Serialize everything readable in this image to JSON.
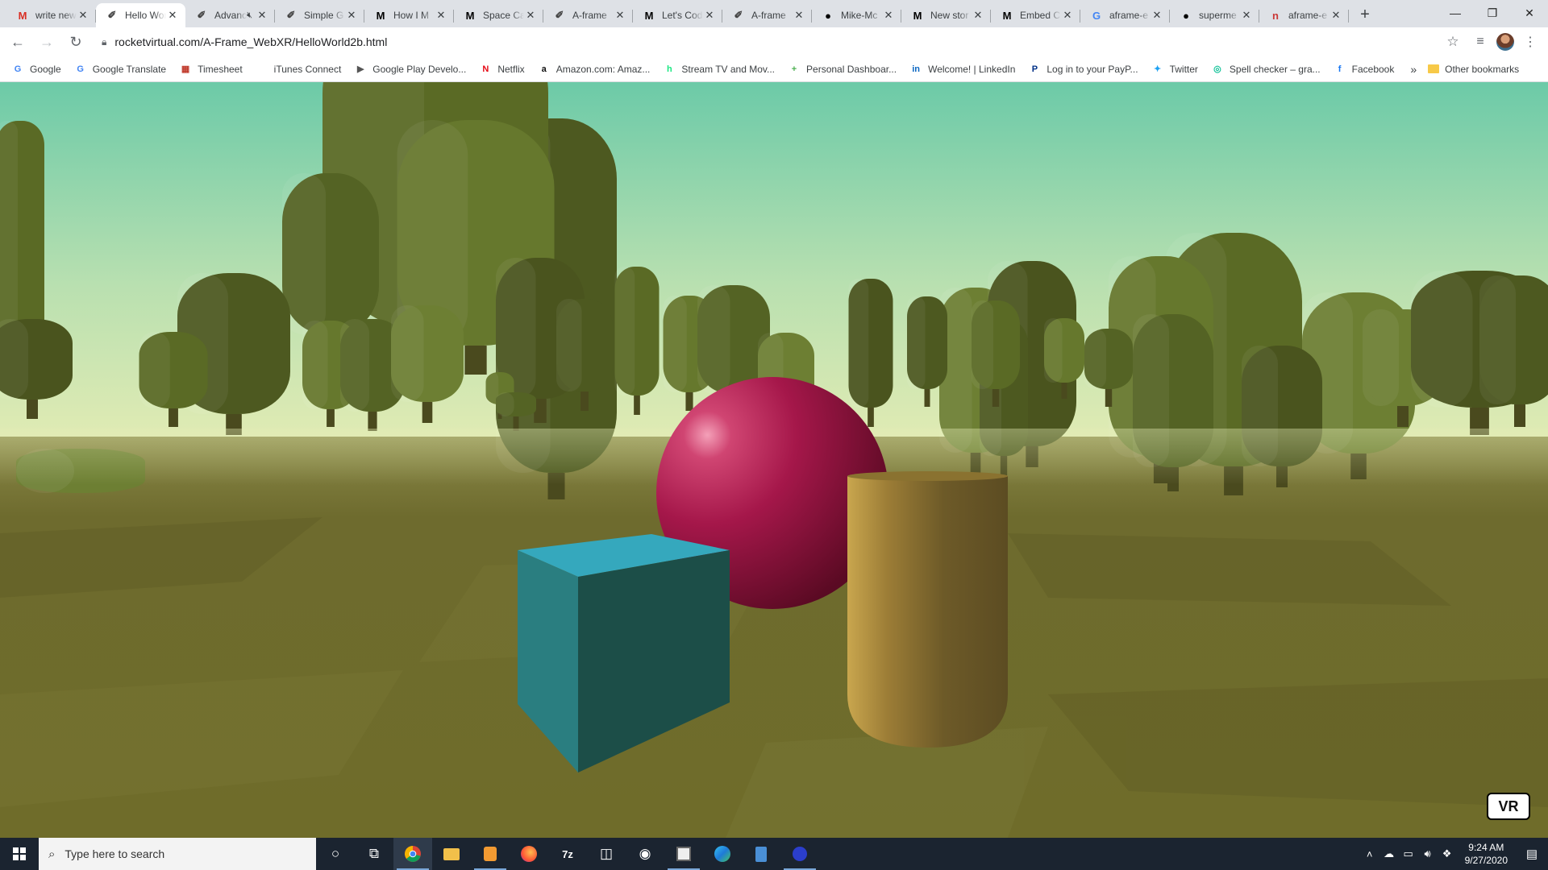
{
  "browser": {
    "tabs": [
      {
        "title": "write new",
        "favicon": "gmail-icon",
        "color": "#d93025",
        "glyph": "M",
        "active": false
      },
      {
        "title": "Hello World",
        "favicon": "aframe-icon",
        "color": "#444",
        "glyph": "✐",
        "active": true
      },
      {
        "title": "Advanced",
        "favicon": "aframe-icon",
        "color": "#444",
        "glyph": "✐",
        "active": false,
        "muted": true
      },
      {
        "title": "Simple G",
        "favicon": "aframe-icon",
        "color": "#444",
        "glyph": "✐",
        "active": false
      },
      {
        "title": "How I M",
        "favicon": "medium-icon",
        "color": "#000",
        "glyph": "M",
        "active": false
      },
      {
        "title": "Space Ca",
        "favicon": "medium-icon",
        "color": "#000",
        "glyph": "M",
        "active": false
      },
      {
        "title": "A-frame",
        "favicon": "aframe-icon",
        "color": "#444",
        "glyph": "✐",
        "active": false
      },
      {
        "title": "Let's Cod",
        "favicon": "medium-icon",
        "color": "#000",
        "glyph": "M",
        "active": false
      },
      {
        "title": "A-frame",
        "favicon": "aframe-icon",
        "color": "#444",
        "glyph": "✐",
        "active": false
      },
      {
        "title": "Mike-Mc",
        "favicon": "github-icon",
        "color": "#000",
        "glyph": "●",
        "active": false
      },
      {
        "title": "New stor",
        "favicon": "medium-icon",
        "color": "#000",
        "glyph": "M",
        "active": false
      },
      {
        "title": "Embed C",
        "favicon": "medium-icon",
        "color": "#000",
        "glyph": "M",
        "active": false
      },
      {
        "title": "aframe-e",
        "favicon": "google-icon",
        "color": "#4285f4",
        "glyph": "G",
        "active": false
      },
      {
        "title": "superme",
        "favicon": "github-icon",
        "color": "#000",
        "glyph": "●",
        "active": false
      },
      {
        "title": "aframe-e",
        "favicon": "npm-icon",
        "color": "#cb3837",
        "glyph": "n",
        "active": false
      }
    ],
    "url": "rocketvirtual.com/A-Frame_WebXR/HelloWorld2b.html",
    "bookmarks": [
      {
        "label": "Google",
        "glyph": "G",
        "color": "#4285f4",
        "icon": "google-icon"
      },
      {
        "label": "Google Translate",
        "glyph": "G",
        "color": "#4285f4",
        "icon": "translate-icon"
      },
      {
        "label": "Timesheet",
        "glyph": "▦",
        "color": "#c0392b",
        "icon": "timesheet-icon"
      },
      {
        "label": "iTunes Connect",
        "glyph": "",
        "color": "#555",
        "icon": "apple-icon"
      },
      {
        "label": "Google Play Develo...",
        "glyph": "▶",
        "color": "#555",
        "icon": "play-icon"
      },
      {
        "label": "Netflix",
        "glyph": "N",
        "color": "#e50914",
        "icon": "netflix-icon"
      },
      {
        "label": "Amazon.com: Amaz...",
        "glyph": "a",
        "color": "#111",
        "icon": "amazon-icon"
      },
      {
        "label": "Stream TV and Mov...",
        "glyph": "h",
        "color": "#1ce783",
        "icon": "hulu-icon"
      },
      {
        "label": "Personal Dashboar...",
        "glyph": "+",
        "color": "#4caf50",
        "icon": "dashboard-icon"
      },
      {
        "label": "Welcome! | LinkedIn",
        "glyph": "in",
        "color": "#0a66c2",
        "icon": "linkedin-icon"
      },
      {
        "label": "Log in to your PayP...",
        "glyph": "P",
        "color": "#003087",
        "icon": "paypal-icon"
      },
      {
        "label": "Twitter",
        "glyph": "✦",
        "color": "#1da1f2",
        "icon": "twitter-icon"
      },
      {
        "label": "Spell checker – gra...",
        "glyph": "◎",
        "color": "#15c39a",
        "icon": "grammarly-icon"
      },
      {
        "label": "Facebook",
        "glyph": "f",
        "color": "#1877f2",
        "icon": "facebook-icon"
      }
    ],
    "bookmarks_more": "»",
    "other_bookmarks": "Other bookmarks"
  },
  "scene": {
    "vr_button": "VR",
    "colors": {
      "sky_top": "#6ccaa8",
      "sky_horizon": "#e0ecb0",
      "ground": "#6f6c2c",
      "box": "#2a7e80",
      "sphere": "#a5174a",
      "cylinder": "#b99848"
    }
  },
  "taskbar": {
    "search_placeholder": "Type here to search",
    "time": "9:24 AM",
    "date": "9/27/2020"
  }
}
